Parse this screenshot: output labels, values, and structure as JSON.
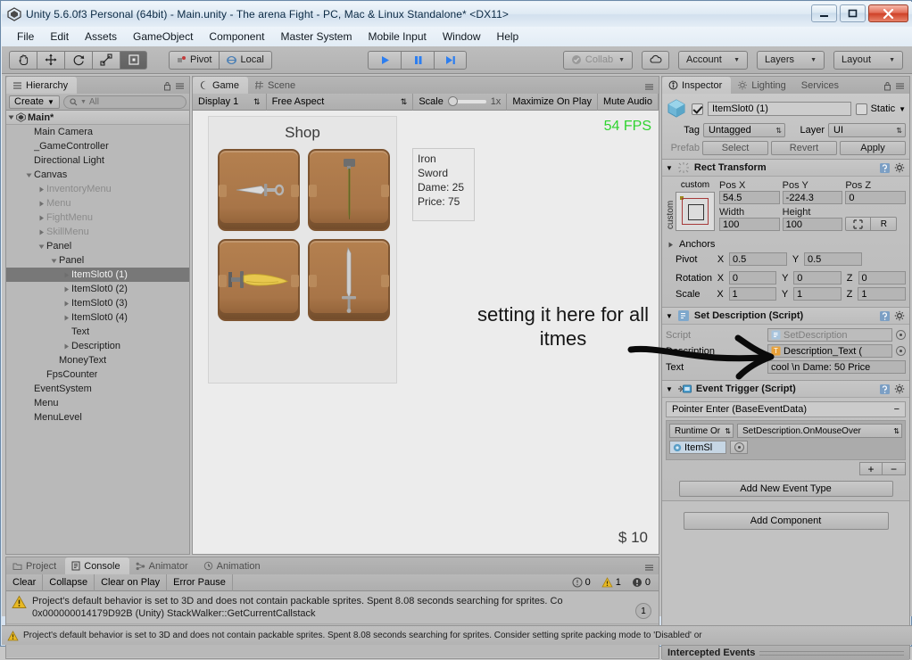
{
  "window": {
    "title": "Unity 5.6.0f3 Personal (64bit) - Main.unity - The arena Fight - PC, Mac & Linux Standalone* <DX11>",
    "minimize": "minimize-icon",
    "maximize": "maximize-icon",
    "close": "close-icon"
  },
  "menubar": {
    "items": [
      "File",
      "Edit",
      "Assets",
      "GameObject",
      "Component",
      "Master System",
      "Mobile Input",
      "Window",
      "Help"
    ]
  },
  "toolbar": {
    "tools": [
      "hand-tool",
      "move-tool",
      "rotate-tool",
      "scale-tool",
      "rect-tool"
    ],
    "pivot_label": "Pivot",
    "local_label": "Local",
    "play_label": "play-icon",
    "pause_label": "pause-icon",
    "step_label": "step-icon",
    "collab_label": "Collab",
    "cloud_label": "cloud-icon",
    "account_label": "Account",
    "layers_label": "Layers",
    "layout_label": "Layout"
  },
  "hierarchy": {
    "tab_label": "Hierarchy",
    "create_label": "Create",
    "search_placeholder": "All",
    "scene_root": "Main*",
    "items": [
      {
        "label": "Main Camera",
        "indent": 1,
        "arrow": "none",
        "dim": false,
        "selected": false
      },
      {
        "label": "_GameController",
        "indent": 1,
        "arrow": "none",
        "dim": false,
        "selected": false
      },
      {
        "label": "Directional Light",
        "indent": 1,
        "arrow": "none",
        "dim": false,
        "selected": false
      },
      {
        "label": "Canvas",
        "indent": 1,
        "arrow": "down",
        "dim": false,
        "selected": false
      },
      {
        "label": "InventoryMenu",
        "indent": 2,
        "arrow": "right",
        "dim": true,
        "selected": false
      },
      {
        "label": "Menu",
        "indent": 2,
        "arrow": "right",
        "dim": true,
        "selected": false
      },
      {
        "label": "FightMenu",
        "indent": 2,
        "arrow": "right",
        "dim": true,
        "selected": false
      },
      {
        "label": "SkillMenu",
        "indent": 2,
        "arrow": "right",
        "dim": true,
        "selected": false
      },
      {
        "label": "Panel",
        "indent": 2,
        "arrow": "down",
        "dim": false,
        "selected": false
      },
      {
        "label": "Panel",
        "indent": 3,
        "arrow": "down",
        "dim": false,
        "selected": false
      },
      {
        "label": "ItemSlot0 (1)",
        "indent": 4,
        "arrow": "right",
        "dim": false,
        "selected": true
      },
      {
        "label": "ItemSlot0 (2)",
        "indent": 4,
        "arrow": "right",
        "dim": false,
        "selected": false
      },
      {
        "label": "ItemSlot0 (3)",
        "indent": 4,
        "arrow": "right",
        "dim": false,
        "selected": false
      },
      {
        "label": "ItemSlot0 (4)",
        "indent": 4,
        "arrow": "right",
        "dim": false,
        "selected": false
      },
      {
        "label": "Text",
        "indent": 4,
        "arrow": "none",
        "dim": false,
        "selected": false
      },
      {
        "label": "Description",
        "indent": 4,
        "arrow": "right",
        "dim": false,
        "selected": false
      },
      {
        "label": "MoneyText",
        "indent": 3,
        "arrow": "none",
        "dim": false,
        "selected": false
      },
      {
        "label": "FpsCounter",
        "indent": 2,
        "arrow": "none",
        "dim": false,
        "selected": false
      },
      {
        "label": "EventSystem",
        "indent": 1,
        "arrow": "none",
        "dim": false,
        "selected": false
      },
      {
        "label": "Menu",
        "indent": 1,
        "arrow": "none",
        "dim": false,
        "selected": false
      },
      {
        "label": "MenuLevel",
        "indent": 1,
        "arrow": "none",
        "dim": false,
        "selected": false
      }
    ]
  },
  "game": {
    "tabs": [
      {
        "label": "Game",
        "icon": "game-icon",
        "active": true
      },
      {
        "label": "Scene",
        "icon": "scene-icon",
        "active": false
      }
    ],
    "display": "Display 1",
    "aspect": "Free Aspect",
    "scale_label": "Scale",
    "scale_value": "1x",
    "maximize_label": "Maximize On Play",
    "mute_label": "Mute Audio",
    "shop_title": "Shop",
    "slots": [
      {
        "name": "dagger-icon"
      },
      {
        "name": "spear-icon"
      },
      {
        "name": "golden-blade-icon"
      },
      {
        "name": "longsword-icon"
      }
    ],
    "tooltip": [
      "Iron Sword",
      "Dame: 25",
      "Price: 75"
    ],
    "fps": "54 FPS",
    "money": "$ 10",
    "annotation": "setting it here for all itmes"
  },
  "console": {
    "tabs": [
      {
        "label": "Project",
        "icon": "project-icon",
        "active": false
      },
      {
        "label": "Console",
        "icon": "console-icon",
        "active": true
      },
      {
        "label": "Animator",
        "icon": "animator-icon",
        "active": false
      },
      {
        "label": "Animation",
        "icon": "animation-icon",
        "active": false
      }
    ],
    "buttons": [
      "Clear",
      "Collapse",
      "Clear on Play",
      "Error Pause"
    ],
    "counts": {
      "info": "0",
      "warning": "1",
      "error": "0"
    },
    "log_line1": "Project's default behavior is set to 3D and does not contain packable sprites. Spent 8.08 seconds searching for sprites. Co",
    "log_line2": "0x000000014179D92B (Unity) StackWalker::GetCurrentCallstack",
    "log_badge": "1"
  },
  "inspector": {
    "tabs": [
      {
        "label": "Inspector",
        "icon": "inspector-icon",
        "active": true
      },
      {
        "label": "Lighting",
        "icon": "lighting-icon",
        "active": false
      },
      {
        "label": "Services",
        "icon": "services-icon",
        "active": false
      }
    ],
    "object_name": "ItemSlot0 (1)",
    "static_label": "Static",
    "tag_label": "Tag",
    "tag_value": "Untagged",
    "layer_label": "Layer",
    "layer_value": "UI",
    "prefab_label": "Prefab",
    "prefab_select": "Select",
    "prefab_revert": "Revert",
    "prefab_apply": "Apply",
    "rect_transform": {
      "title": "Rect Transform",
      "preset_label": "custom",
      "preset_vert_label": "custom",
      "pos_x_label": "Pos X",
      "pos_y_label": "Pos Y",
      "pos_z_label": "Pos Z",
      "pos_x": "54.5",
      "pos_y": "-224.3",
      "pos_z": "0",
      "width_label": "Width",
      "height_label": "Height",
      "width": "100",
      "height": "100",
      "blueprint_btn": "blueprint-icon",
      "raw_btn": "R",
      "anchors_label": "Anchors",
      "pivot_label": "Pivot",
      "pivot_x": "0.5",
      "pivot_y": "0.5",
      "rotation_label": "Rotation",
      "rot_x": "0",
      "rot_y": "0",
      "rot_z": "0",
      "scale_label": "Scale",
      "scale_x": "1",
      "scale_y": "1",
      "scale_z": "1"
    },
    "set_description": {
      "title": "Set Description (Script)",
      "script_label": "Script",
      "script_value": "SetDescription",
      "description_label": "Description",
      "description_value": "Description_Text (",
      "text_label": "Text",
      "text_value": "cool \\n Dame: 50 Price"
    },
    "event_trigger": {
      "title": "Event Trigger (Script)",
      "event_name": "Pointer Enter (BaseEventData)",
      "remove_label": "−",
      "runtime_label": "Runtime Or",
      "function_label": "SetDescription.OnMouseOver",
      "target_label": "ItemSl",
      "plus_label": "+",
      "minus_label": "−",
      "add_event_label": "Add New Event Type"
    },
    "add_component_label": "Add Component",
    "intercepted_label": "Intercepted Events"
  },
  "statusbar": {
    "message": "Project's default behavior is set to 3D and does not contain packable sprites. Spent 8.08 seconds searching for sprites. Consider setting sprite packing mode to 'Disabled' or"
  },
  "colors": {
    "accent_blue": "#2c7ef0",
    "fps_green": "#2fd32f",
    "warning_yellow": "#e8b923",
    "slot_brown": "#a87548",
    "selection_gray": "#787878"
  }
}
